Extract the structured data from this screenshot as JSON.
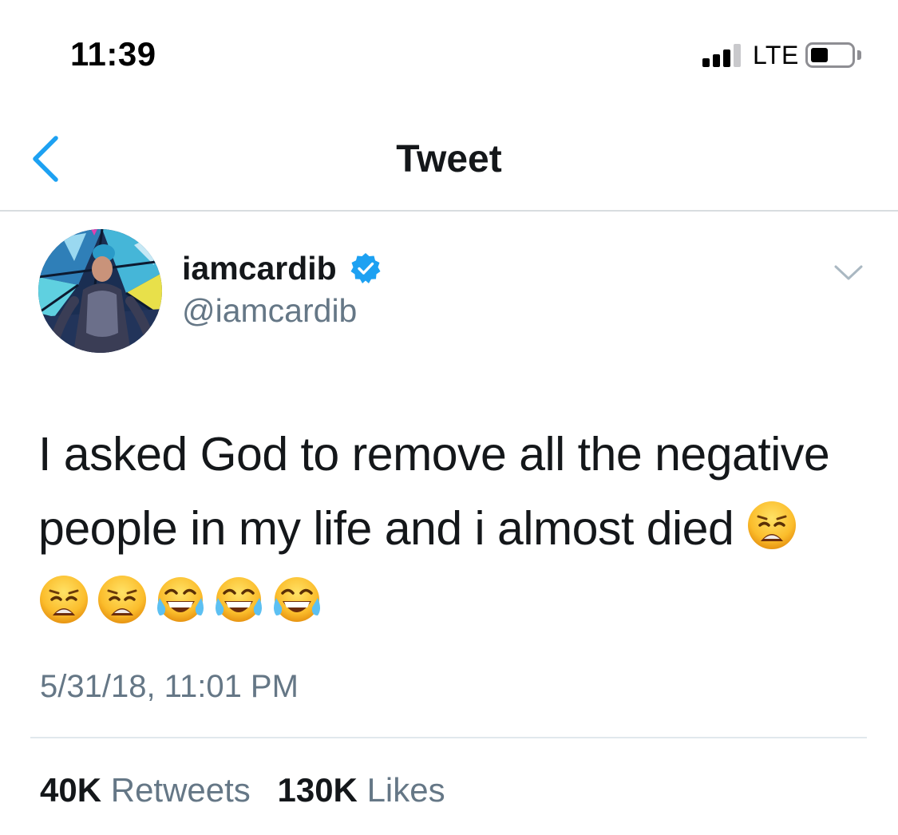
{
  "status_bar": {
    "time": "11:39",
    "network": "LTE",
    "icons": [
      "signal-icon",
      "battery-icon"
    ]
  },
  "nav": {
    "title": "Tweet",
    "back_icon": "chevron-left-icon",
    "accent_color": "#1da1f2"
  },
  "tweet": {
    "author": {
      "display_name": "iamcardib",
      "handle": "@iamcardib",
      "verified": true,
      "verified_icon": "verified-badge-icon"
    },
    "menu_icon": "chevron-down-icon",
    "text_line_1": "I asked God to remove all the negative",
    "text_line_2": "people in my life and i almost died",
    "emojis": [
      "weary-face",
      "weary-face",
      "weary-face",
      "face-with-tears-of-joy",
      "face-with-tears-of-joy",
      "face-with-tears-of-joy"
    ],
    "timestamp": "5/31/18, 11:01 PM",
    "stats": {
      "retweets_count": "40K",
      "retweets_label": "Retweets",
      "likes_count": "130K",
      "likes_label": "Likes"
    }
  },
  "colors": {
    "text_primary": "#14171a",
    "text_secondary": "#657786",
    "divider": "#e1e8ed",
    "verified_blue": "#1da1f2"
  }
}
